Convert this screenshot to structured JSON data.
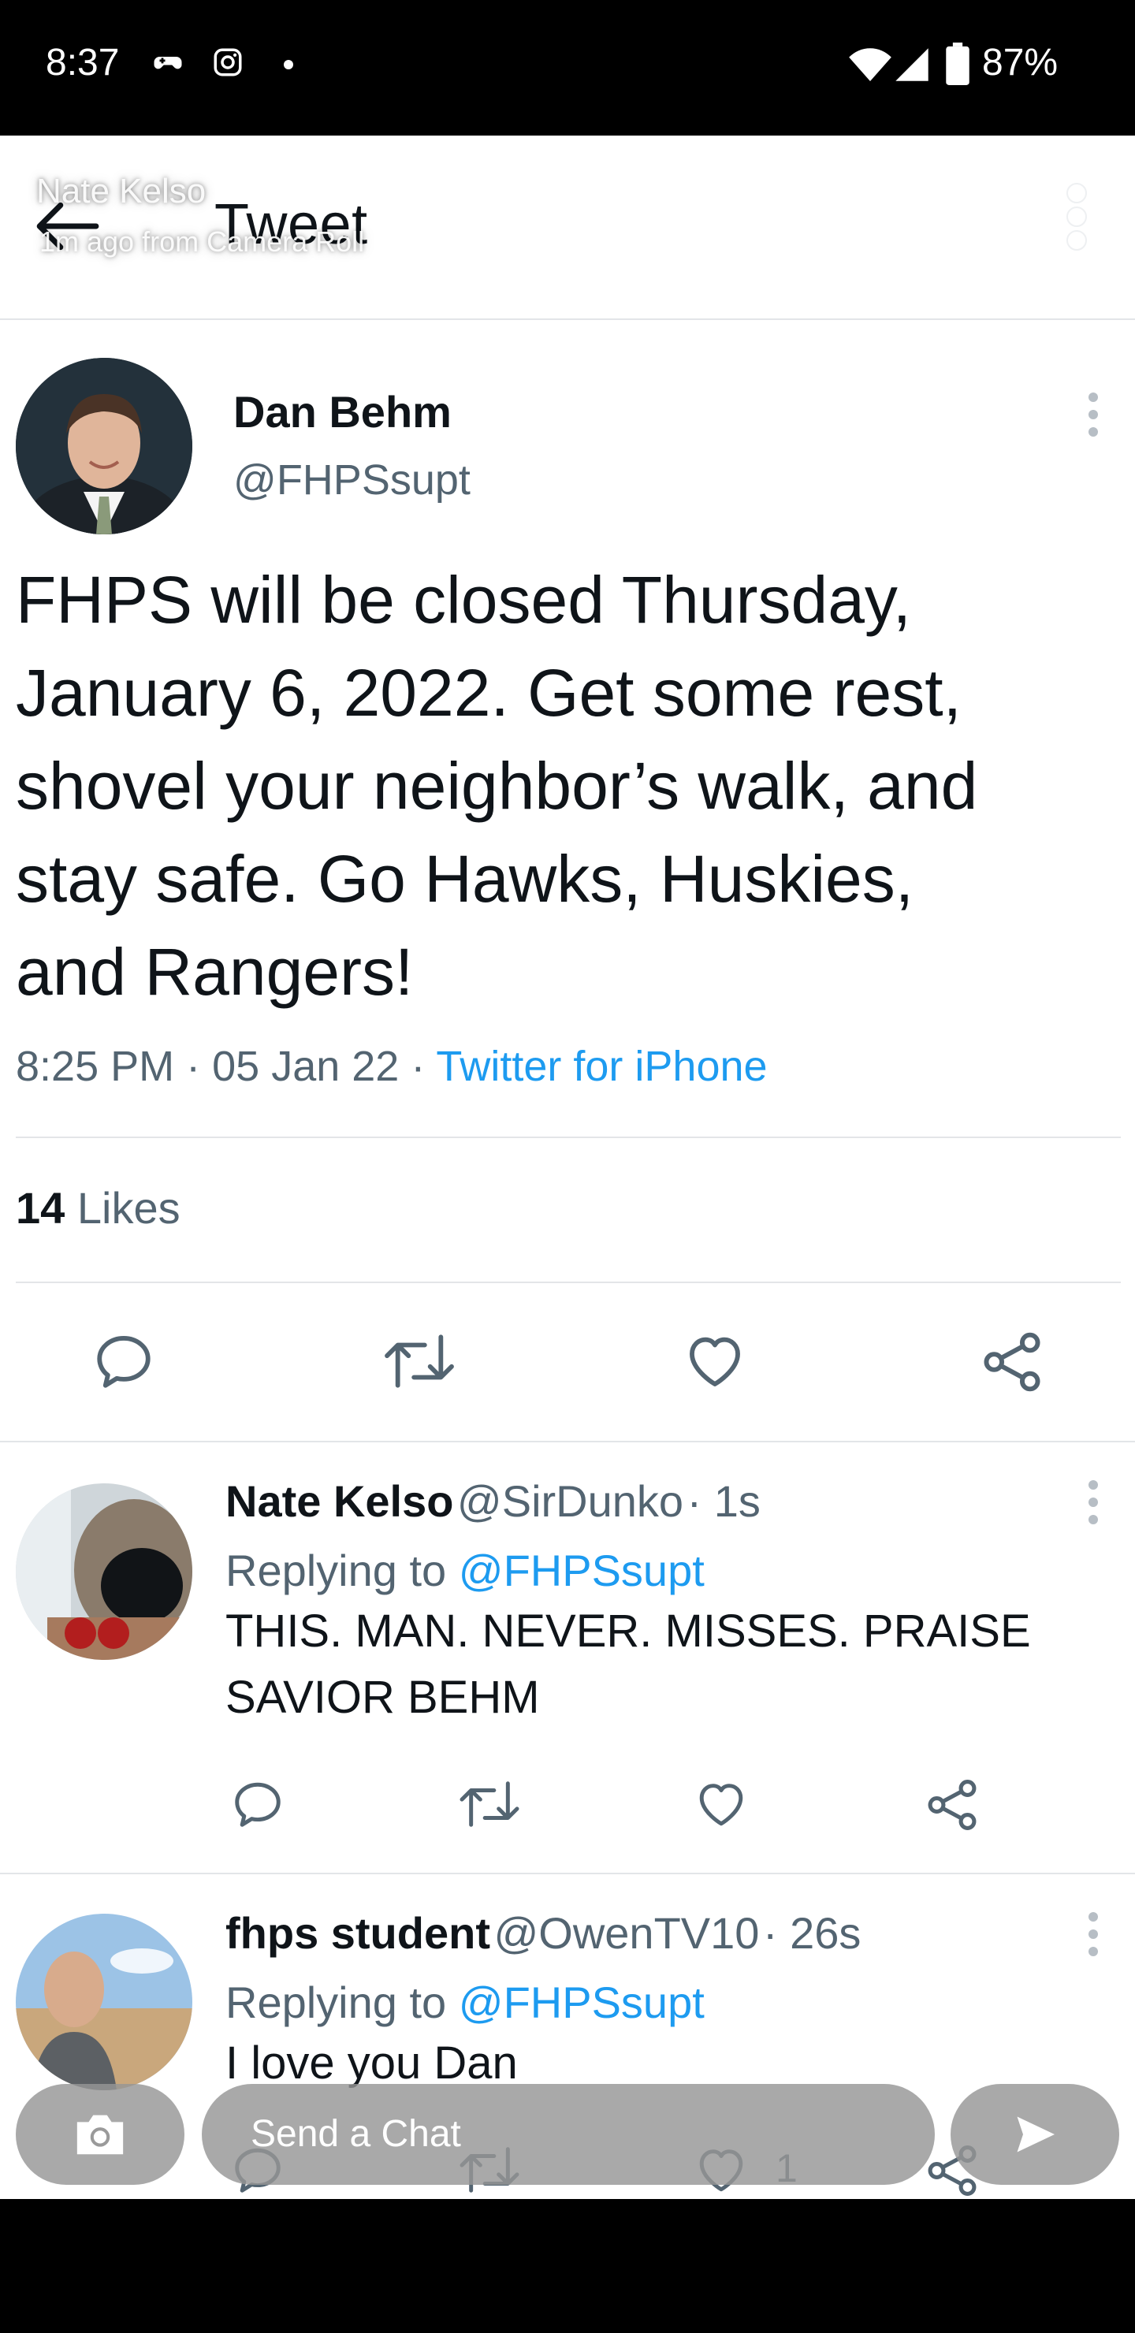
{
  "status_bar": {
    "time": "8:37",
    "battery": "87%"
  },
  "header": {
    "title": "Tweet",
    "overlay_name": "Nate Kelso",
    "overlay_subtitle": "1m ago from Camera Roll"
  },
  "tweet": {
    "author": "Dan Behm",
    "handle": "@FHPSsupt",
    "text_lines": [
      "FHPS will be closed Thursday,",
      "January 6, 2022. Get some rest,",
      "shovel your neighbor’s walk, and",
      "stay safe. Go Hawks, Huskies,",
      "and Rangers!"
    ],
    "time": "8:25 PM",
    "date": "05 Jan 22",
    "source": "Twitter for iPhone",
    "likes_count": "14",
    "likes_label": "Likes"
  },
  "replies": [
    {
      "name": "Nate Kelso",
      "handle": "@SirDunko",
      "age": "1s",
      "replying_prefix": "Replying to",
      "replying_to": "@FHPSsupt",
      "text_lines": [
        "THIS. MAN. NEVER. MISSES. PRAISE",
        "SAVIOR BEHM"
      ]
    },
    {
      "name": "fhps student",
      "handle": "@OwenTV10",
      "age": "26s",
      "replying_prefix": "Replying to",
      "replying_to": "@FHPSsupt",
      "text_lines": [
        "I love you Dan"
      ],
      "like_count": "1"
    }
  ],
  "chat_bar": {
    "placeholder": "Send a Chat"
  },
  "colors": {
    "link": "#1d9bf0",
    "secondary_text": "#536471",
    "divider": "#e3e5e8"
  },
  "icons": [
    "back-arrow-icon",
    "camera-icon",
    "send-arrow-icon",
    "reply-icon",
    "retweet-icon",
    "like-icon",
    "share-icon",
    "more-vertical-icon"
  ]
}
